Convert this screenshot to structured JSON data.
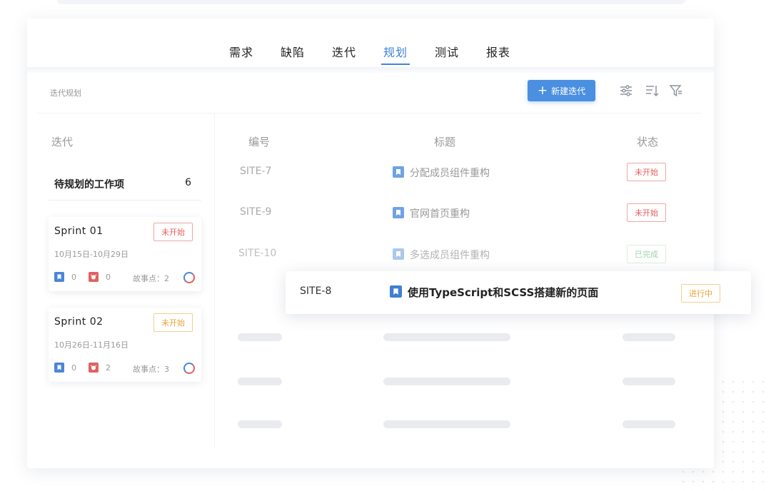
{
  "nav": {
    "tabs": [
      {
        "label": "需求"
      },
      {
        "label": "缺陷"
      },
      {
        "label": "迭代"
      },
      {
        "label": "规划",
        "active": true
      },
      {
        "label": "测试"
      },
      {
        "label": "报表"
      }
    ]
  },
  "toolbar": {
    "title": "迭代规划",
    "new_button_label": "新建迭代",
    "icons": [
      "settings-sliders-icon",
      "sort-icon",
      "filter-icon"
    ]
  },
  "sidebar": {
    "title": "迭代",
    "pending": {
      "label": "待规划的工作项",
      "count": "6"
    },
    "sprints": [
      {
        "name": "Sprint 01",
        "status": "未开始",
        "dates": "10月15日-10月29日",
        "stories": "0",
        "bugs": "0",
        "points_label": "故事点：",
        "points": "2"
      },
      {
        "name": "Sprint 02",
        "status": "未开始",
        "dates": "10月26日-11月16日",
        "stories": "0",
        "bugs": "2",
        "points_label": "故事点：",
        "points": "3"
      }
    ]
  },
  "table": {
    "headers": {
      "id": "编号",
      "title": "标题",
      "status": "状态"
    },
    "rows": [
      {
        "id": "SITE-7",
        "title": "分配成员组件重构",
        "status": "未开始"
      },
      {
        "id": "SITE-9",
        "title": "官网首页重构",
        "status": "未开始"
      },
      {
        "id": "SITE-10",
        "title": "多选成员组件重构",
        "status": "已完成"
      }
    ],
    "dragging": {
      "id": "SITE-8",
      "title": "使用TypeScript和SCSS搭建新的页面",
      "status": "进行中"
    }
  },
  "colors": {
    "accent": "#3f83d6",
    "button": "#4a8fe0",
    "status_not_started": "#e55f5f",
    "status_in_progress": "#e8a43b",
    "status_done": "#7cc68f"
  }
}
